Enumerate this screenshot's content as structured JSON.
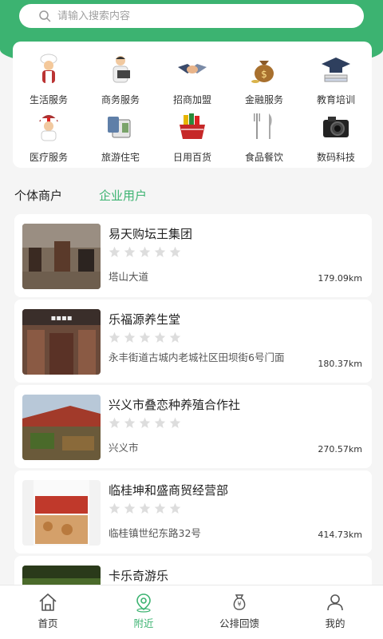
{
  "search": {
    "placeholder": "请输入搜索内容",
    "icon": "search-icon"
  },
  "categories": [
    {
      "label": "生活服务",
      "icon": "chef-icon"
    },
    {
      "label": "商务服务",
      "icon": "businessman-icon"
    },
    {
      "label": "招商加盟",
      "icon": "handshake-icon"
    },
    {
      "label": "金融服务",
      "icon": "money-bag-icon"
    },
    {
      "label": "教育培训",
      "icon": "graduation-cap-icon"
    },
    {
      "label": "医疗服务",
      "icon": "nurse-icon"
    },
    {
      "label": "旅游住宅",
      "icon": "travel-icon"
    },
    {
      "label": "日用百货",
      "icon": "shopping-basket-icon"
    },
    {
      "label": "食品餐饮",
      "icon": "cutlery-icon"
    },
    {
      "label": "数码科技",
      "icon": "camera-icon"
    }
  ],
  "tabs": {
    "individual": "个体商户",
    "enterprise": "企业用户",
    "active": "enterprise"
  },
  "businesses": [
    {
      "name": "易天购坛王集团",
      "rating": 0,
      "address": "塔山大道",
      "distance": "179.09km"
    },
    {
      "name": "乐福源养生堂",
      "rating": 0,
      "address": "永丰街道古城内老城社区田坝街6号门面",
      "distance": "180.37km"
    },
    {
      "name": "兴义市叠恋种养殖合作社",
      "rating": 0,
      "address": "兴义市",
      "distance": "270.57km"
    },
    {
      "name": "临桂坤和盛商贸经营部",
      "rating": 0,
      "address": "临桂镇世纪东路32号",
      "distance": "414.73km"
    },
    {
      "name": "卡乐奇游乐",
      "rating": 0,
      "address": "",
      "distance": ""
    }
  ],
  "tabbar": {
    "home": "首页",
    "nearby": "附近",
    "feedback": "公排回馈",
    "mine": "我的",
    "active": "nearby"
  },
  "colors": {
    "accent": "#3cb371",
    "star": "#dddddd"
  }
}
